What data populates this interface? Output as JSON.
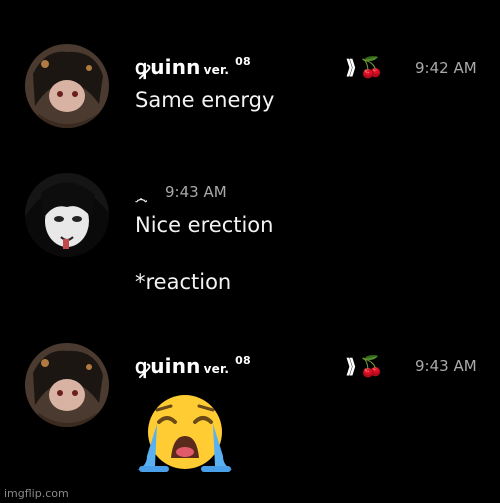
{
  "messages": [
    {
      "user": {
        "name": "ꝙuinn",
        "ver": "ver.",
        "sup": "08",
        "tags": "⟫",
        "tag_emoji": "🍒"
      },
      "time": "9:42 AM",
      "lines": [
        "Same energy"
      ]
    },
    {
      "user": {
        "status_icon": "swirl-icon"
      },
      "time": "9:43 AM",
      "lines": [
        "Nice erection",
        "*reaction"
      ]
    },
    {
      "user": {
        "name": "ꝙuinn",
        "ver": "ver.",
        "sup": "08",
        "tags": "⟫",
        "tag_emoji": "🍒"
      },
      "time": "9:43 AM",
      "emoji": "😭"
    }
  ],
  "watermark": "imgflip.com"
}
